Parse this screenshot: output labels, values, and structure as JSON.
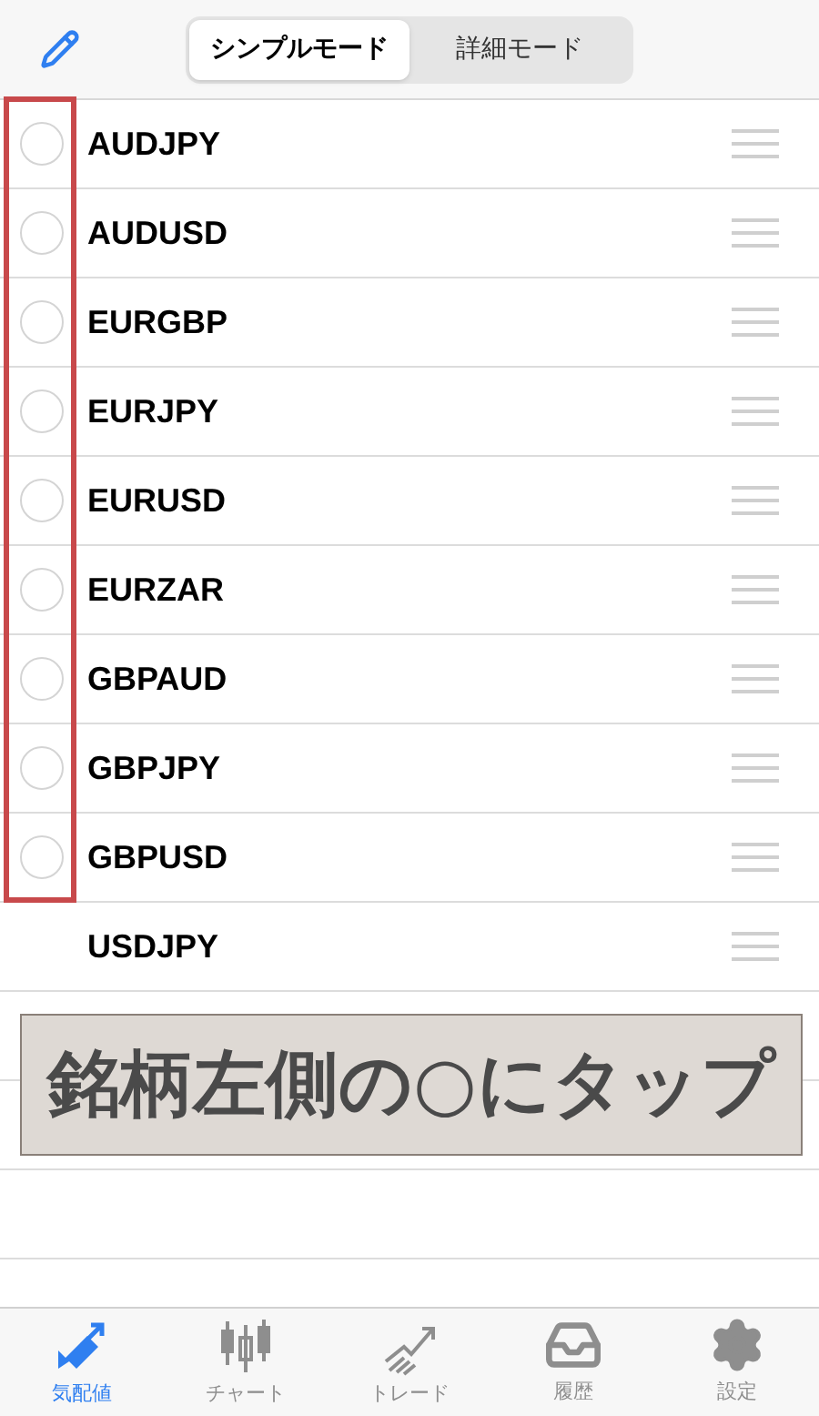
{
  "header": {
    "segments": [
      {
        "label": "シンプルモード",
        "selected": true
      },
      {
        "label": "詳細モード",
        "selected": false
      }
    ]
  },
  "rows": [
    {
      "symbol": "AUDJPY",
      "kind": "selectable"
    },
    {
      "symbol": "AUDUSD",
      "kind": "selectable"
    },
    {
      "symbol": "EURGBP",
      "kind": "selectable"
    },
    {
      "symbol": "EURJPY",
      "kind": "selectable"
    },
    {
      "symbol": "EURUSD",
      "kind": "selectable"
    },
    {
      "symbol": "EURZAR",
      "kind": "selectable"
    },
    {
      "symbol": "GBPAUD",
      "kind": "selectable"
    },
    {
      "symbol": "GBPJPY",
      "kind": "selectable"
    },
    {
      "symbol": "GBPUSD",
      "kind": "selectable"
    },
    {
      "symbol": "USDJPY",
      "kind": "fixed"
    }
  ],
  "callout": "銘柄左側の○にタップ",
  "tab_bar": [
    {
      "label": "気配値",
      "kind": "quotes",
      "selected": true
    },
    {
      "label": "チャート",
      "kind": "chart",
      "selected": false
    },
    {
      "label": "トレード",
      "kind": "trade",
      "selected": false
    },
    {
      "label": "履歴",
      "kind": "history",
      "selected": false
    },
    {
      "label": "設定",
      "kind": "settings",
      "selected": false
    }
  ]
}
